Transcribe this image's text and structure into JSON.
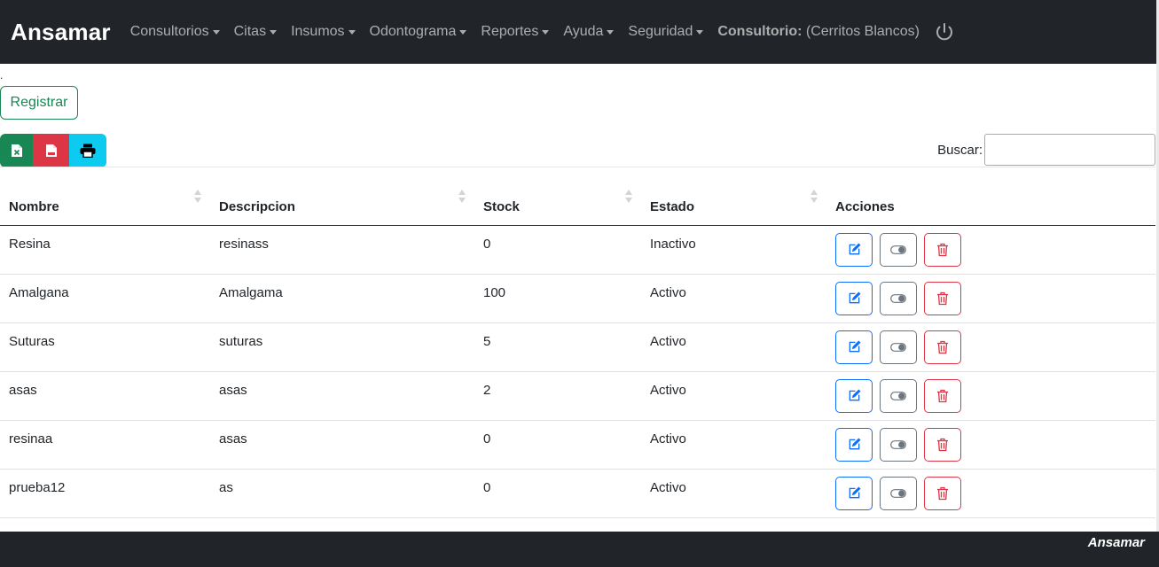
{
  "navbar": {
    "brand": "Ansamar",
    "items": [
      {
        "label": "Consultorios"
      },
      {
        "label": "Citas"
      },
      {
        "label": "Insumos"
      },
      {
        "label": "Odontograma"
      },
      {
        "label": "Reportes"
      },
      {
        "label": "Ayuda"
      },
      {
        "label": "Seguridad"
      }
    ],
    "consultorio_label": "Consultorio:",
    "consultorio_value": "(Cerritos Blancos)"
  },
  "page": {
    "dot": ".",
    "register_label": "Registrar",
    "search_label": "Buscar:",
    "search_value": ""
  },
  "export": {
    "excel_icon": "excel-file-icon",
    "pdf_icon": "pdf-file-icon",
    "print_icon": "printer-icon"
  },
  "table": {
    "headers": [
      "Nombre",
      "Descripcion",
      "Stock",
      "Estado",
      "Acciones"
    ],
    "rows": [
      {
        "nombre": "Resina",
        "descripcion": "resinass",
        "stock": "0",
        "estado": "Inactivo"
      },
      {
        "nombre": "Amalgana",
        "descripcion": "Amalgama",
        "stock": "100",
        "estado": "Activo"
      },
      {
        "nombre": "Suturas",
        "descripcion": "suturas",
        "stock": "5",
        "estado": "Activo"
      },
      {
        "nombre": "asas",
        "descripcion": "asas",
        "stock": "2",
        "estado": "Activo"
      },
      {
        "nombre": "resinaa",
        "descripcion": "asas",
        "stock": "0",
        "estado": "Activo"
      },
      {
        "nombre": "prueba12",
        "descripcion": "as",
        "stock": "0",
        "estado": "Activo"
      }
    ]
  },
  "footer": {
    "brand": "Ansamar"
  },
  "colors": {
    "navbar": "#212529",
    "success": "#198754",
    "danger": "#dc3545",
    "info": "#0dcaf0",
    "primary": "#0d6efd",
    "secondary": "#6c757d"
  }
}
